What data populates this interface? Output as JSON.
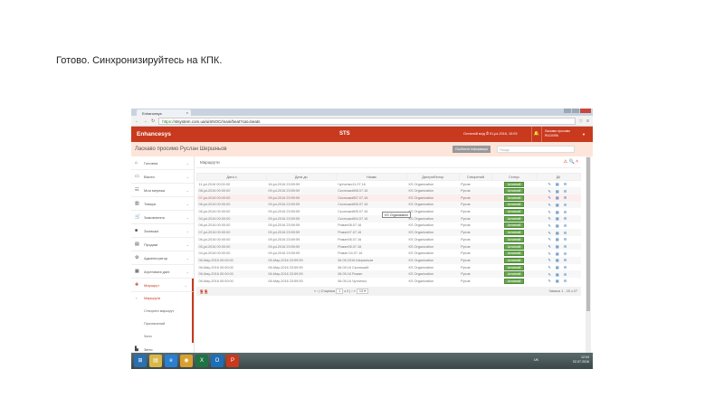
{
  "slide": {
    "title": "Готово. Синхронизируйтесь на КПК."
  },
  "browser": {
    "tab_title": "Enhancesys",
    "url_scheme": "https://",
    "url_rest": "stsystem.com.ua/uiSNOC/main/beat?cat=beats"
  },
  "header": {
    "logo": "Enhancesys",
    "app": "STS",
    "last_login": "Останній вхід ⏱ 01-jul-2016, 10:03",
    "user_line1": "Ласкаво просимо",
    "user_line2": "RU10096"
  },
  "welcome": {
    "text": "Ласкаво просимо Руслан Шершньов",
    "info_button": "Особиста інформація",
    "search_placeholder": "Пошук"
  },
  "sidebar": {
    "items": [
      {
        "label": "Головна",
        "icon": "⌂"
      },
      {
        "label": "Візити",
        "icon": "▭"
      },
      {
        "label": "Моя мережа",
        "icon": "☷"
      },
      {
        "label": "Товари",
        "icon": "▥"
      },
      {
        "label": "Замовлення",
        "icon": "🛒"
      },
      {
        "label": "Залишки",
        "icon": "■"
      },
      {
        "label": "Продажі",
        "icon": "▤"
      },
      {
        "label": "Адміністратор",
        "icon": "⚙"
      },
      {
        "label": "Агреговані дані",
        "icon": "▦"
      },
      {
        "label": "Маршрут",
        "icon": "✚"
      }
    ],
    "subitems": [
      {
        "label": "Маршрути"
      },
      {
        "label": "Створити маршрут"
      },
      {
        "label": "Призначений"
      },
      {
        "label": "Зони"
      }
    ],
    "last": {
      "label": "Звіти",
      "icon": "▙"
    }
  },
  "page": {
    "title": "Маршрути",
    "tools": "⚠ 🔍 ˄"
  },
  "table": {
    "headers": [
      "Дата з",
      "Дата до",
      "Назва",
      "Дистриб'ютор",
      "Створений",
      "Статус",
      "Дії"
    ],
    "rows": [
      [
        "11-jul-2016 00:00:00",
        "16-jul-2016 23:59:59",
        "Чутченко11.07.16",
        "KS Organization",
        "Русов",
        "Активний"
      ],
      [
        "08-jul-2016 00:00:00",
        "09-jul-2016 23:59:59",
        "Скопський08.07.16",
        "KS Organization",
        "Русов",
        "Активний"
      ],
      [
        "07-jul-2016 00:00:00",
        "09-jul-2016 23:59:59",
        "Скопський07.07.16",
        "KS Organization",
        "Русов",
        "Активний"
      ],
      [
        "06-jul-2016 00:00:00",
        "09-jul-2016 23:59:59",
        "Скопський06.07.16",
        "KS Organization",
        "Русов",
        "Активний"
      ],
      [
        "05-jul-2016 00:00:00",
        "09-jul-2016 23:59:59",
        "Скопський05.07.16",
        "KS Organization",
        "Русов",
        "Активний"
      ],
      [
        "04-jul-2016 00:00:00",
        "09-jul-2016 23:59:59",
        "Скопський04.07.16",
        "KS Organization",
        "Русов",
        "Активний"
      ],
      [
        "08-jul-2016 00:00:00",
        "09-jul-2016 23:59:59",
        "Роман08.07.16",
        "KS Organization",
        "Русов",
        "Активний"
      ],
      [
        "07-jul-2016 00:00:00",
        "09-jul-2016 23:59:59",
        "Роман07.07.16",
        "KS Organization",
        "Русов",
        "Активний"
      ],
      [
        "06-jul-2016 00:00:00",
        "09-jul-2016 23:59:59",
        "Роман06.07.16",
        "KS Organization",
        "Русов",
        "Активний"
      ],
      [
        "05-jul-2016 00:00:00",
        "09-jul-2016 23:59:59",
        "Роман05.07.16",
        "KS Organization",
        "Русов",
        "Активний"
      ],
      [
        "04-jul-2016 00:00:00",
        "09-jul-2016 23:59:59",
        "Роман 04.07.16",
        "KS Organization",
        "Русов",
        "Активний"
      ],
      [
        "06-May-2016 00:00:00",
        "06-May-2016 23:59:59",
        "06.05.2016 Шершньов",
        "KS Organization",
        "Русов",
        "Активний"
      ],
      [
        "06-May-2016 00:00:00",
        "06-May-2016 23:59:59",
        "06.05.16 Скопський",
        "KS Organization",
        "Русов",
        "Активний"
      ],
      [
        "06-May-2016 00:00:00",
        "06-May-2016 23:59:59",
        "06.05.16 Роман",
        "KS Organization",
        "Русов",
        "Активний"
      ],
      [
        "06-May-2016 00:00:00",
        "06-May-2016 23:59:59",
        "06.05.16 Чутченко",
        "KS Organization",
        "Русов",
        "Активний"
      ]
    ],
    "actions": "✎ ▦ ⚙",
    "tooltip": "KS Organization"
  },
  "pager": {
    "first": "«",
    "prev": "‹",
    "page_label": "Сторінка",
    "page": "1",
    "of": "з 2",
    "next": "›",
    "last": "»",
    "per_page": "15 ▾",
    "records": "Записи 1 - 15 з 27"
  },
  "taskbar": {
    "apps": [
      {
        "label": "⊞",
        "color": "#2a6fb0"
      },
      {
        "label": "▤",
        "color": "#d9b84a"
      },
      {
        "label": "e",
        "color": "#2a7fd0"
      },
      {
        "label": "◉",
        "color": "#d9a030"
      },
      {
        "label": "X",
        "color": "#207245"
      },
      {
        "label": "O",
        "color": "#1d6fb8"
      },
      {
        "label": "P",
        "color": "#c8391e"
      }
    ],
    "lang": "UK",
    "time": "12:04",
    "date": "02.07.2016"
  },
  "colors": {
    "brand": "#c8391e",
    "status": "#6aa84f"
  }
}
